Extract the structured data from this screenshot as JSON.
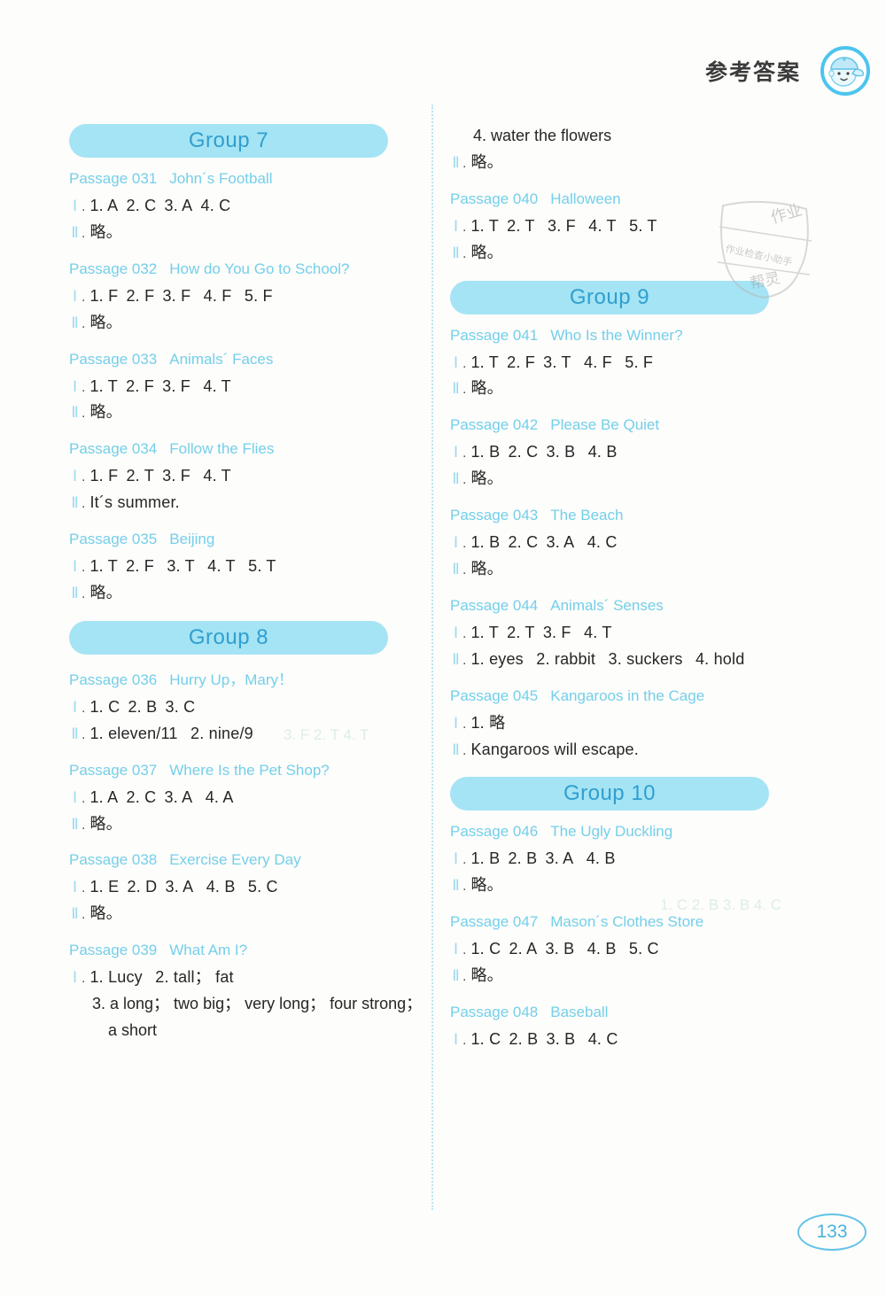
{
  "header": {
    "title": "参考答案",
    "avatar_icon": "boy-with-cap-avatar-icon"
  },
  "page_number": "133",
  "watermark": {
    "line_top": "作业",
    "line_middle": "作业检查小助手",
    "line_bottom": "帮灵"
  },
  "colors": {
    "banner_bg": "#a5e4f4",
    "banner_text": "#2f9fd0",
    "passage_heading": "#74cfea",
    "roman_numeral": "#9ed9ee",
    "answer_text": "#262626",
    "page_number": "#4ab2dd",
    "divider": "#b9e3f2",
    "background": "#fdfdfb"
  },
  "left_column": [
    {
      "type": "group",
      "label": "Group 7"
    },
    {
      "type": "passage",
      "number": "Passage 031",
      "title": "John´s Football",
      "lines": [
        {
          "numeral": "Ⅰ",
          "text": "1. A 2. C 3. A 4. C"
        },
        {
          "numeral": "Ⅱ",
          "text": "略。"
        }
      ]
    },
    {
      "type": "passage",
      "number": "Passage 032",
      "title": "How do You Go to School?",
      "lines": [
        {
          "numeral": "Ⅰ",
          "text": "1. F 2. F 3. F  4. F  5. F"
        },
        {
          "numeral": "Ⅱ",
          "text": "略。"
        }
      ]
    },
    {
      "type": "passage",
      "number": "Passage 033",
      "title": "Animals´ Faces",
      "lines": [
        {
          "numeral": "Ⅰ",
          "text": "1. T 2. F 3. F  4. T"
        },
        {
          "numeral": "Ⅱ",
          "text": "略。"
        }
      ]
    },
    {
      "type": "passage",
      "number": "Passage 034",
      "title": "Follow the Flies",
      "lines": [
        {
          "numeral": "Ⅰ",
          "text": "1. F 2. T 3. F  4. T"
        },
        {
          "numeral": "Ⅱ",
          "text": "It´s summer."
        }
      ]
    },
    {
      "type": "passage",
      "number": "Passage 035",
      "title": "Beijing",
      "lines": [
        {
          "numeral": "Ⅰ",
          "text": "1. T 2. F  3. T  4. T  5. T"
        },
        {
          "numeral": "Ⅱ",
          "text": "略。"
        }
      ]
    },
    {
      "type": "group",
      "label": "Group 8"
    },
    {
      "type": "passage",
      "number": "Passage 036",
      "title": "Hurry Up，Mary！",
      "lines": [
        {
          "numeral": "Ⅰ",
          "text": "1. C 2. B 3. C"
        },
        {
          "numeral": "Ⅱ",
          "text": "1. eleven/11  2. nine/9"
        }
      ]
    },
    {
      "type": "passage",
      "number": "Passage 037",
      "title": "Where Is the Pet Shop?",
      "lines": [
        {
          "numeral": "Ⅰ",
          "text": "1. A 2. C 3. A  4. A"
        },
        {
          "numeral": "Ⅱ",
          "text": "略。"
        }
      ]
    },
    {
      "type": "passage",
      "number": "Passage 038",
      "title": "Exercise Every Day",
      "lines": [
        {
          "numeral": "Ⅰ",
          "text": "1. E 2. D 3. A  4. B  5. C"
        },
        {
          "numeral": "Ⅱ",
          "text": "略。"
        }
      ]
    },
    {
      "type": "passage",
      "number": "Passage 039",
      "title": "What Am I?",
      "lines": [
        {
          "numeral": "Ⅰ",
          "text": "1. Lucy  2. tall； fat"
        },
        {
          "continuation": "3. a long； two big； very long； four strong；"
        },
        {
          "continuation2": "a short"
        }
      ]
    }
  ],
  "right_column": [
    {
      "type": "orphan",
      "lines": [
        {
          "continuation": "4. water the flowers"
        },
        {
          "numeral": "Ⅱ",
          "text": "略。"
        }
      ]
    },
    {
      "type": "passage",
      "number": "Passage 040",
      "title": "Halloween",
      "lines": [
        {
          "numeral": "Ⅰ",
          "text": "1. T 2. T  3. F  4. T  5. T"
        },
        {
          "numeral": "Ⅱ",
          "text": "略。"
        }
      ]
    },
    {
      "type": "group",
      "label": "Group 9"
    },
    {
      "type": "passage",
      "number": "Passage 041",
      "title": "Who Is the Winner?",
      "lines": [
        {
          "numeral": "Ⅰ",
          "text": "1. T 2. F 3. T  4. F  5. F"
        },
        {
          "numeral": "Ⅱ",
          "text": "略。"
        }
      ]
    },
    {
      "type": "passage",
      "number": "Passage 042",
      "title": "Please Be Quiet",
      "lines": [
        {
          "numeral": "Ⅰ",
          "text": "1. B 2. C 3. B  4. B"
        },
        {
          "numeral": "Ⅱ",
          "text": "略。"
        }
      ]
    },
    {
      "type": "passage",
      "number": "Passage 043",
      "title": "The Beach",
      "lines": [
        {
          "numeral": "Ⅰ",
          "text": "1. B 2. C 3. A  4. C"
        },
        {
          "numeral": "Ⅱ",
          "text": "略。"
        }
      ]
    },
    {
      "type": "passage",
      "number": "Passage 044",
      "title": "Animals´ Senses",
      "lines": [
        {
          "numeral": "Ⅰ",
          "text": "1. T 2. T 3. F  4. T"
        },
        {
          "numeral": "Ⅱ",
          "text": "1. eyes  2. rabbit  3. suckers  4. hold"
        }
      ]
    },
    {
      "type": "passage",
      "number": "Passage 045",
      "title": "Kangaroos in the Cage",
      "lines": [
        {
          "numeral": "Ⅰ",
          "text": "1. 略"
        },
        {
          "numeral": "Ⅱ",
          "text": "Kangaroos will escape."
        }
      ]
    },
    {
      "type": "group",
      "label": "Group 10"
    },
    {
      "type": "passage",
      "number": "Passage 046",
      "title": "The Ugly Duckling",
      "lines": [
        {
          "numeral": "Ⅰ",
          "text": "1. B 2. B 3. A  4. B"
        },
        {
          "numeral": "Ⅱ",
          "text": "略。"
        }
      ]
    },
    {
      "type": "passage",
      "number": "Passage 047",
      "title": "Mason´s Clothes Store",
      "lines": [
        {
          "numeral": "Ⅰ",
          "text": "1. C 2. A 3. B  4. B  5. C"
        },
        {
          "numeral": "Ⅱ",
          "text": "略。"
        }
      ]
    },
    {
      "type": "passage",
      "number": "Passage 048",
      "title": "Baseball",
      "lines": [
        {
          "numeral": "Ⅰ",
          "text": "1. C 2. B 3. B  4. C"
        }
      ]
    }
  ]
}
